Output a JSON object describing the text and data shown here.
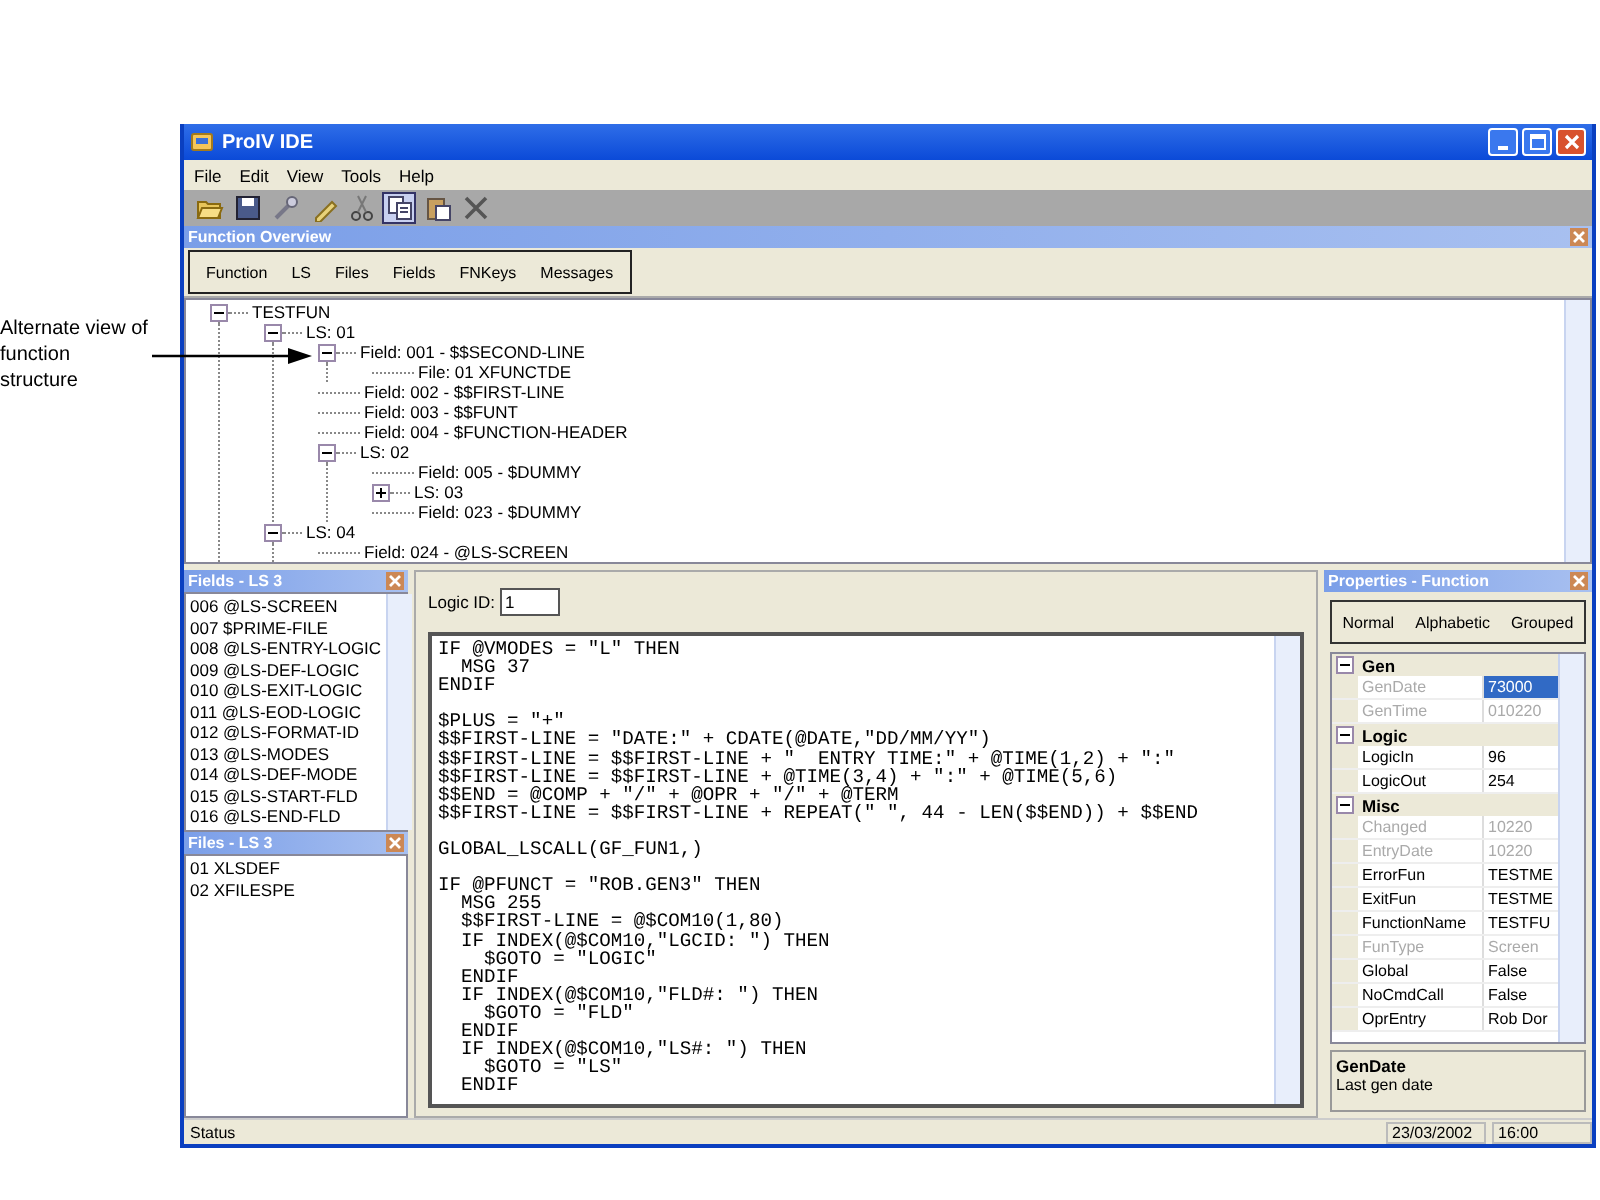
{
  "annotation": {
    "text": "Alternate view of function structure"
  },
  "window": {
    "title": "ProIV IDE"
  },
  "menu": [
    "File",
    "Edit",
    "View",
    "Tools",
    "Help"
  ],
  "toolbar": [
    {
      "pressed": false
    },
    {
      "pressed": false
    },
    {
      "pressed": false
    },
    {
      "pressed": false
    },
    {
      "pressed": false
    },
    {
      "pressed": true
    },
    {
      "pressed": false
    },
    {
      "pressed": false
    }
  ],
  "overview": {
    "title": "Function Overview",
    "tabs": [
      "Function",
      "LS",
      "Files",
      "Fields",
      "FNKeys",
      "Messages"
    ],
    "tree": [
      {
        "label": "TESTFUN",
        "expanded": true,
        "children": [
          {
            "label": "LS: 01",
            "expanded": true,
            "children": [
              {
                "label": "Field: 001 - $$SECOND-LINE",
                "expanded": true,
                "children": [
                  {
                    "label": "File: 01 XFUNCTDE"
                  }
                ]
              },
              {
                "label": "Field: 002 - $$FIRST-LINE"
              },
              {
                "label": "Field: 003 - $$FUNT"
              },
              {
                "label": "Field: 004 - $FUNCTION-HEADER"
              },
              {
                "label": "LS: 02",
                "expanded": true,
                "children": [
                  {
                    "label": "Field: 005 - $DUMMY"
                  },
                  {
                    "label": "LS: 03",
                    "expanded": false
                  },
                  {
                    "label": "Field: 023 - $DUMMY"
                  }
                ]
              }
            ]
          },
          {
            "label": "LS: 04",
            "expanded": true,
            "children": [
              {
                "label": "Field: 024 - @LS-SCREEN"
              }
            ]
          }
        ]
      }
    ]
  },
  "fields_panel": {
    "title": "Fields - LS 3",
    "items": [
      "006 @LS-SCREEN",
      "007 $PRIME-FILE",
      "008 @LS-ENTRY-LOGIC",
      "009 @LS-DEF-LOGIC",
      "010 @LS-EXIT-LOGIC",
      "011 @LS-EOD-LOGIC",
      "012 @LS-FORMAT-ID",
      "013 @LS-MODES",
      "014 @LS-DEF-MODE",
      "015 @LS-START-FLD",
      "016 @LS-END-FLD"
    ]
  },
  "files_panel": {
    "title": "Files - LS 3",
    "items": [
      "01 XLSDEF",
      "02 XFILESPE"
    ]
  },
  "editor": {
    "logic_id_label": "Logic ID:",
    "logic_id": "1",
    "code": "IF @VMODES = \"L\" THEN\n  MSG 37\nENDIF\n\n$PLUS = \"+\"\n$$FIRST-LINE = \"DATE:\" + CDATE(@DATE,\"DD/MM/YY\")\n$$FIRST-LINE = $$FIRST-LINE + \"  ENTRY TIME:\" + @TIME(1,2) + \":\"\n$$FIRST-LINE = $$FIRST-LINE + @TIME(3,4) + \":\" + @TIME(5,6)\n$$END = @COMP + \"/\" + @OPR + \"/\" + @TERM\n$$FIRST-LINE = $$FIRST-LINE + REPEAT(\" \", 44 - LEN($$END)) + $$END\n\nGLOBAL_LSCALL(GF_FUN1,)\n\nIF @PFUNCT = \"ROB.GEN3\" THEN\n  MSG 255\n  $$FIRST-LINE = @$COM10(1,80)\n  IF INDEX(@$COM10,\"LGCID: \") THEN\n    $GOTO = \"LOGIC\"\n  ENDIF\n  IF INDEX(@$COM10,\"FLD#: \") THEN\n    $GOTO = \"FLD\"\n  ENDIF\n  IF INDEX(@$COM10,\"LS#: \") THEN\n    $GOTO = \"LS\"\n  ENDIF"
  },
  "properties": {
    "title": "Properties - Function",
    "tabs": [
      "Normal",
      "Alphabetic",
      "Grouped"
    ],
    "groups": [
      {
        "name": "Gen",
        "expanded": true,
        "rows": [
          {
            "name": "GenDate",
            "value": "73000",
            "disabled": true,
            "selected": true
          },
          {
            "name": "GenTime",
            "value": "010220",
            "disabled": true,
            "selected": false
          }
        ]
      },
      {
        "name": "Logic",
        "expanded": true,
        "rows": [
          {
            "name": "LogicIn",
            "value": "96",
            "disabled": false,
            "selected": false
          },
          {
            "name": "LogicOut",
            "value": "254",
            "disabled": false,
            "selected": false
          }
        ]
      },
      {
        "name": "Misc",
        "expanded": true,
        "rows": [
          {
            "name": "Changed",
            "value": "10220",
            "disabled": true,
            "selected": false
          },
          {
            "name": "EntryDate",
            "value": "10220",
            "disabled": true,
            "selected": false
          },
          {
            "name": "ErrorFun",
            "value": "TESTME",
            "disabled": false,
            "selected": false
          },
          {
            "name": "ExitFun",
            "value": "TESTME",
            "disabled": false,
            "selected": false
          },
          {
            "name": "FunctionName",
            "value": "TESTFU",
            "disabled": false,
            "selected": false
          },
          {
            "name": "FunType",
            "value": "Screen",
            "disabled": true,
            "selected": false
          },
          {
            "name": "Global",
            "value": "False",
            "disabled": false,
            "selected": false
          },
          {
            "name": "NoCmdCall",
            "value": "False",
            "disabled": false,
            "selected": false
          },
          {
            "name": "OprEntry",
            "value": "Rob Dor",
            "disabled": false,
            "selected": false
          }
        ]
      }
    ],
    "description_title": "GenDate",
    "description": "Last gen date"
  },
  "status_bar": {
    "text": "Status",
    "date": "23/03/2002",
    "time": "16:00"
  }
}
